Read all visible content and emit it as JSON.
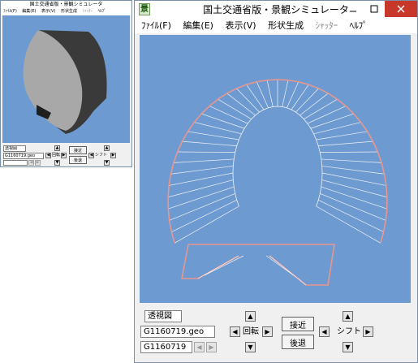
{
  "small_window": {
    "title": "国土交通省版・景観シミュレータ",
    "menu": [
      {
        "label": "ﾌｧｲﾙ(F)",
        "enabled": true
      },
      {
        "label": "編集(E)",
        "enabled": true
      },
      {
        "label": "表示(V)",
        "enabled": true
      },
      {
        "label": "形状生成",
        "enabled": true
      },
      {
        "label": "ｼｬｯﾀｰ",
        "enabled": false
      },
      {
        "label": "ﾍﾙﾌﾟ",
        "enabled": true
      }
    ],
    "view_mode": "透視図",
    "file_name": "G1160719.geo",
    "rotate_label": "回転",
    "zoom_in_label": "接近",
    "zoom_out_label": "後退",
    "shift_label": "シフト",
    "colors": {
      "viewport": "#6d9bd1",
      "shape_body": "#a8a8a8",
      "shape_side": "#3a3a3a"
    }
  },
  "large_window": {
    "title": "国土交通省版・景観シミュレータ",
    "menu": [
      {
        "label": "ﾌｧｲﾙ(F)",
        "enabled": true
      },
      {
        "label": "編集(E)",
        "enabled": true
      },
      {
        "label": "表示(V)",
        "enabled": true
      },
      {
        "label": "形状生成",
        "enabled": true
      },
      {
        "label": "ｼｬｯﾀｰ",
        "enabled": false
      },
      {
        "label": "ﾍﾙﾌﾟ",
        "enabled": true
      }
    ],
    "view_mode": "透視図",
    "file_name": "G1160719.geo",
    "object_name": "G1160719",
    "rotate_label": "回転",
    "zoom_in_label": "接近",
    "zoom_out_label": "後退",
    "shift_label": "シフト",
    "colors": {
      "viewport": "#6d9bd1",
      "outline": "#e89690",
      "wireframe": "#f2f2f2"
    }
  }
}
